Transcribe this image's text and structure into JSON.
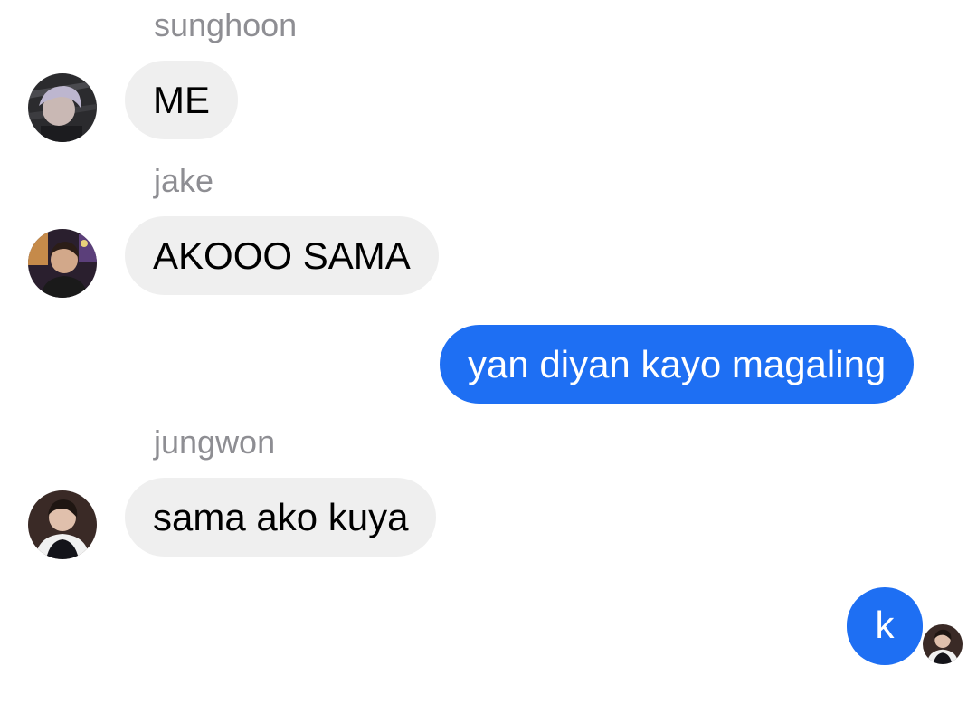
{
  "colors": {
    "incoming_bubble": "#efefef",
    "outgoing_bubble": "#1e6ff3",
    "sender_name": "#8e8e93"
  },
  "messages": [
    {
      "sender": "sunghoon",
      "text": "ME",
      "direction": "incoming",
      "avatar_icon": "sunghoon-avatar"
    },
    {
      "sender": "jake",
      "text": "AKOOO SAMA",
      "direction": "incoming",
      "avatar_icon": "jake-avatar"
    },
    {
      "text": "yan diyan kayo magaling",
      "direction": "outgoing"
    },
    {
      "sender": "jungwon",
      "text": "sama ako kuya",
      "direction": "incoming",
      "avatar_icon": "jungwon-avatar"
    },
    {
      "text": "k",
      "direction": "outgoing",
      "read_receipt_icon": "read-receipt-avatar"
    }
  ]
}
